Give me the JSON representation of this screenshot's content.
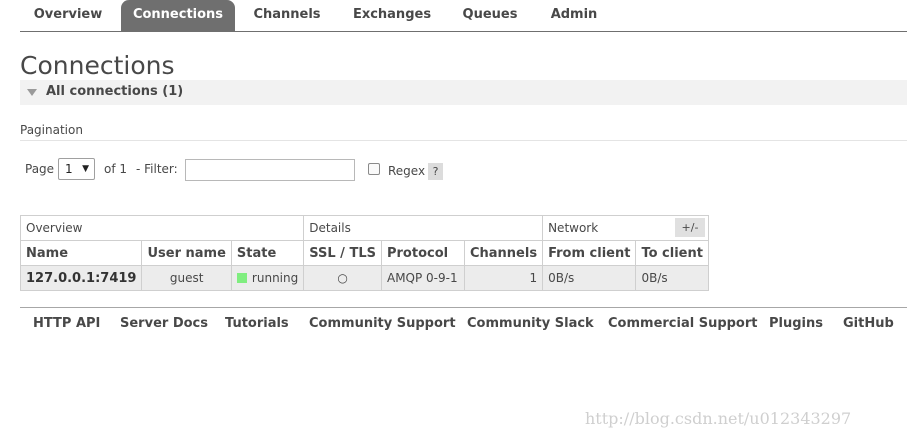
{
  "nav": {
    "tabs": [
      {
        "label": "Overview"
      },
      {
        "label": "Connections",
        "active": true
      },
      {
        "label": "Channels"
      },
      {
        "label": "Exchanges"
      },
      {
        "label": "Queues"
      },
      {
        "label": "Admin"
      }
    ]
  },
  "page_title": "Connections",
  "section": {
    "label": "All connections (1)",
    "icon": "triangle-down-icon"
  },
  "pagination": {
    "label": "Pagination",
    "page_label": "Page",
    "page_value": "1",
    "page_dropdown_icon": "chevron-down-icon",
    "of_label": "of 1",
    "filter_label": "- Filter:",
    "filter_value": "",
    "regex_label": "Regex",
    "regex_checked": false,
    "help_label": "?"
  },
  "table": {
    "groups": [
      "Overview",
      "Details",
      "Network"
    ],
    "columns": [
      "Name",
      "User name",
      "State",
      "SSL / TLS",
      "Protocol",
      "Channels",
      "From client",
      "To client"
    ],
    "rows": [
      {
        "name": "127.0.0.1:7419",
        "user": "guest",
        "state": "running",
        "ssl": "○",
        "protocol": "AMQP 0-9-1",
        "channels": "1",
        "from_client": "0B/s",
        "to_client": "0B/s"
      }
    ],
    "columns_toggle": "+/-",
    "state_color": "#80ee80"
  },
  "footer": {
    "links": [
      "HTTP API",
      "Server Docs",
      "Tutorials",
      "Community Support",
      "Community Slack",
      "Commercial Support",
      "Plugins",
      "GitHub"
    ]
  },
  "watermark": "http://blog.csdn.net/u012343297",
  "colors": {
    "active_tab": "#6f6f6f",
    "text": "#484848",
    "section_bg": "#f2f2f2",
    "row_bg": "#ececec"
  }
}
